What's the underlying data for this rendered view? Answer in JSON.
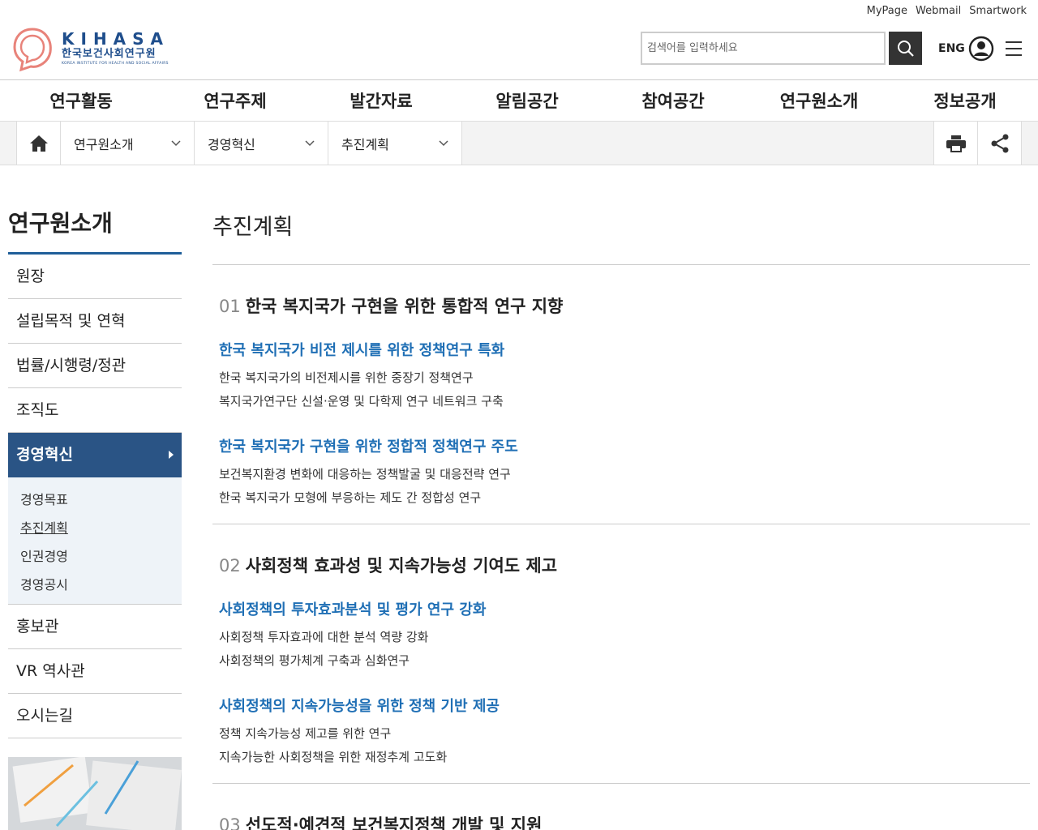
{
  "util_links": [
    "MyPage",
    "Webmail",
    "Smartwork"
  ],
  "logo": {
    "en": "KIHASA",
    "ko": "한국보건사회연구원",
    "sub": "KOREA INSTITUTE FOR HEALTH AND SOCIAL AFFAIRS"
  },
  "search": {
    "placeholder": "검색어를 입력하세요"
  },
  "header": {
    "eng_label": "ENG"
  },
  "gnb": [
    "연구활동",
    "연구주제",
    "발간자료",
    "알림공간",
    "참여공간",
    "연구원소개",
    "정보공개"
  ],
  "location": {
    "level1": "연구원소개",
    "level2": "경영혁신",
    "level3": "추진계획"
  },
  "sidebar": {
    "title": "연구원소개",
    "items": [
      "원장",
      "설립목적 및 연혁",
      "법률/시행령/정관",
      "조직도",
      "경영혁신",
      "홍보관",
      "VR 역사관",
      "오시는길"
    ],
    "active_index": 4,
    "sub_items": [
      "경영목표",
      "추진계획",
      "인권경영",
      "경영공시"
    ],
    "current_sub_index": 1
  },
  "content": {
    "title": "추진계획",
    "sections": [
      {
        "num": "01",
        "title": "한국 복지국가 구현을 위한 통합적 연구 지향",
        "subs": [
          {
            "head": "한국 복지국가 비전 제시를 위한 정책연구 특화",
            "lines": [
              "한국 복지국가의 비전제시를 위한 중장기 정책연구",
              "복지국가연구단 신설·운영 및 다학제 연구 네트워크 구축"
            ]
          },
          {
            "head": "한국 복지국가 구현을 위한 정합적 정책연구 주도",
            "lines": [
              "보건복지환경 변화에 대응하는 정책발굴 및 대응전략 연구",
              "한국 복지국가 모형에 부응하는 제도 간 정합성 연구"
            ]
          }
        ]
      },
      {
        "num": "02",
        "title": "사회정책 효과성 및 지속가능성 기여도 제고",
        "subs": [
          {
            "head": "사회정책의 투자효과분석 및 평가 연구 강화",
            "lines": [
              "사회정책 투자효과에 대한 분석 역량 강화",
              "사회정책의 평가체계 구축과 심화연구"
            ]
          },
          {
            "head": "사회정책의 지속가능성을 위한 정책 기반 제공",
            "lines": [
              "정책 지속가능성 제고를 위한 연구",
              "지속가능한 사회정책을 위한 재정추계 고도화"
            ]
          }
        ]
      },
      {
        "num": "03",
        "title": "선도적·예견적 보건복지정책 개발 및 지원",
        "subs": []
      }
    ]
  },
  "colors": {
    "brand": "#1f4e8c",
    "accent_blue": "#1f6fb5",
    "sidebar_active": "#2a5485"
  }
}
